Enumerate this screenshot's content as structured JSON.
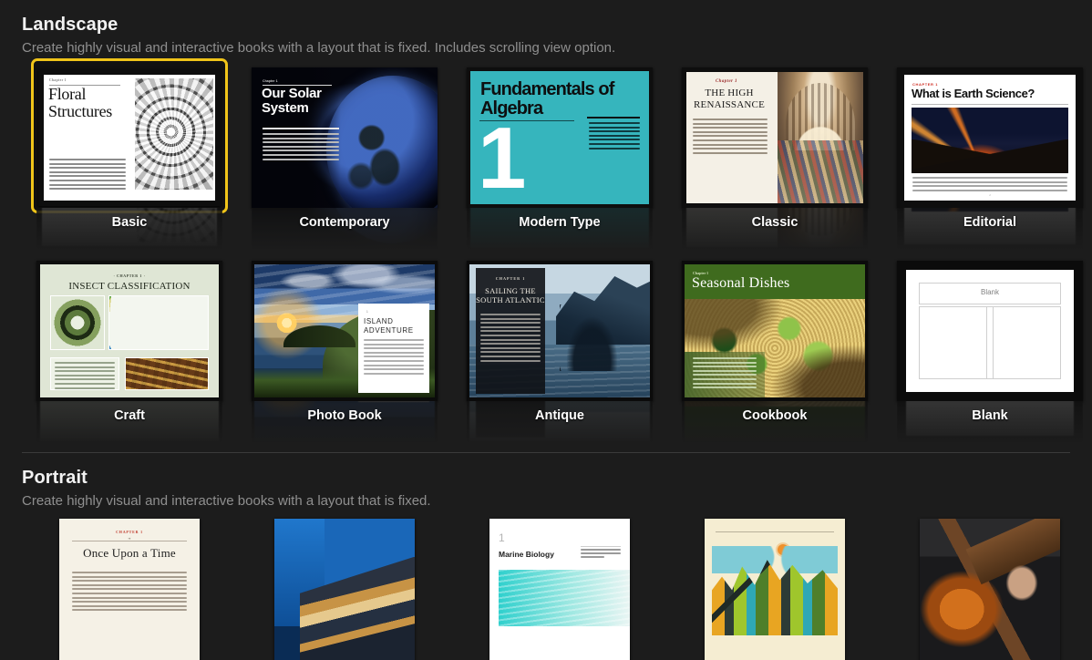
{
  "sections": [
    {
      "id": "landscape",
      "title": "Landscape",
      "subtitle": "Create highly visual and interactive books with a layout that is fixed. Includes scrolling view option.",
      "rows": [
        [
          {
            "label": "Basic",
            "selected": true,
            "theme": "t-basic",
            "chapter": "Chapter 1",
            "heading": "Floral Structures"
          },
          {
            "label": "Contemporary",
            "selected": false,
            "theme": "t-contemp",
            "chapter": "Chapter 1",
            "heading": "Our Solar System"
          },
          {
            "label": "Modern Type",
            "selected": false,
            "theme": "t-modern",
            "chapter": "",
            "heading": "Fundamentals of Algebra",
            "number": "1"
          },
          {
            "label": "Classic",
            "selected": false,
            "theme": "t-classic",
            "chapter": "Chapter 1",
            "heading": "THE HIGH RENAISSANCE"
          },
          {
            "label": "Editorial",
            "selected": false,
            "theme": "t-edit",
            "chapter": "CHAPTER 1",
            "heading": "What is Earth Science?",
            "pagenum": "2"
          }
        ],
        [
          {
            "label": "Craft",
            "selected": false,
            "theme": "t-craft",
            "chapter": "· CHAPTER 1 ·",
            "heading": "INSECT CLASSIFICATION"
          },
          {
            "label": "Photo Book",
            "selected": false,
            "theme": "t-photo",
            "chapter": "1",
            "heading": "ISLAND ADVENTURE"
          },
          {
            "label": "Antique",
            "selected": false,
            "theme": "t-antique",
            "chapter": "CHAPTER 1",
            "heading": "SAILING THE SOUTH ATLANTIC"
          },
          {
            "label": "Cookbook",
            "selected": false,
            "theme": "t-cook",
            "chapter": "Chapter 1",
            "heading": "Seasonal Dishes"
          },
          {
            "label": "Blank",
            "selected": false,
            "theme": "t-blank",
            "chapter": "",
            "heading": "Blank"
          }
        ]
      ]
    },
    {
      "id": "portrait",
      "title": "Portrait",
      "subtitle": "Create highly visual and interactive books with a layout that is fixed.",
      "rows": [
        [
          {
            "label": "",
            "selected": false,
            "theme": "p-fairy",
            "chapter": "CHAPTER 1",
            "heading": "Once Upon a Time"
          },
          {
            "label": "",
            "selected": false,
            "theme": "p-arch",
            "chapter": "",
            "heading": ""
          },
          {
            "label": "",
            "selected": false,
            "theme": "p-marine",
            "chapter": "1",
            "heading": "Marine Biology"
          },
          {
            "label": "",
            "selected": false,
            "theme": "p-town",
            "chapter": "",
            "heading": ""
          },
          {
            "label": "",
            "selected": false,
            "theme": "p-guitar",
            "chapter": "",
            "heading": ""
          }
        ]
      ]
    }
  ],
  "colors": {
    "background": "#1c1c1c",
    "selection": "#f0c419",
    "title": "#f2f2f2",
    "subtitle": "#8f8f8f",
    "divider": "#3a3a3a",
    "label": "#ffffff"
  }
}
